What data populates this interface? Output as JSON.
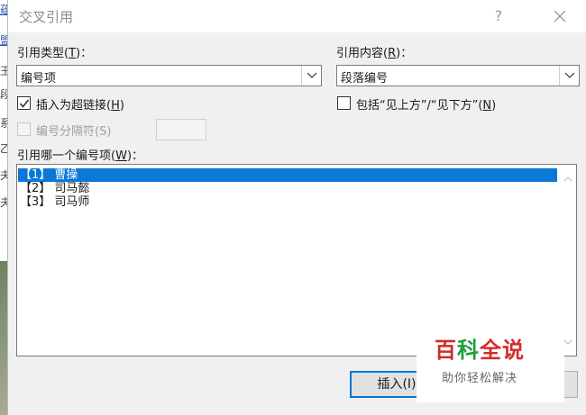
{
  "background": {
    "doc_chars": [
      "蕴",
      "盟",
      "王",
      "段",
      "系",
      "乙",
      "夫",
      "夫"
    ]
  },
  "dialog": {
    "title": "交叉引用",
    "help_label": "?",
    "close_icon": "close-icon",
    "ref_type": {
      "label_prefix": "引用类型(",
      "label_key": "T",
      "label_suffix": ")：",
      "value": "编号项"
    },
    "ref_content": {
      "label_prefix": "引用内容(",
      "label_key": "R",
      "label_suffix": ")：",
      "value": "段落编号"
    },
    "insert_hyperlink": {
      "label_prefix": "插入为超链接(",
      "label_key": "H",
      "label_suffix": ")",
      "checked": true
    },
    "include_above_below": {
      "label_prefix": "包括“见上方”/“见下方”(",
      "label_key": "N",
      "label_suffix": ")",
      "checked": false
    },
    "separator": {
      "label": "编号分隔符(S)",
      "enabled": false
    },
    "which_item": {
      "label_prefix": "引用哪一个编号项(",
      "label_key": "W",
      "label_suffix": ")："
    },
    "items": [
      {
        "text": "【1】 曹操",
        "selected": true
      },
      {
        "text": "【2】 司马懿",
        "selected": false
      },
      {
        "text": "【3】 司马师",
        "selected": false
      }
    ],
    "insert_button": "插入(I)",
    "cancel_button": ""
  },
  "watermark": {
    "title_a": "百",
    "title_b": "科",
    "title_c": "全说",
    "subtitle": "助你轻松解决"
  },
  "colors": {
    "selection": "#0a78d7",
    "watermark_red": "#d42a2a",
    "watermark_green": "#1f9e3c"
  }
}
